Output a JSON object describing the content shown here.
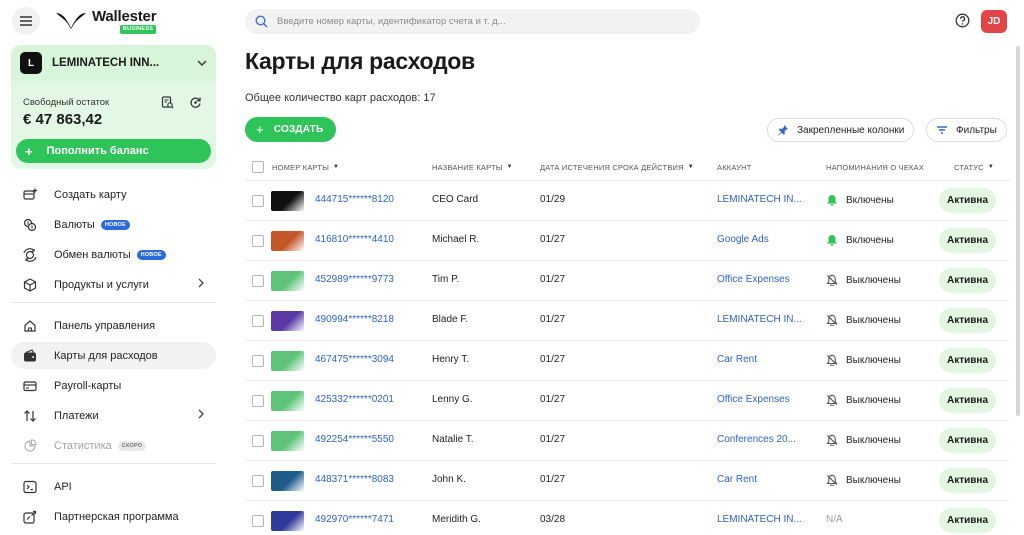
{
  "brand": {
    "name": "Wallester",
    "badge": "BUSINESS"
  },
  "company": {
    "initial": "L",
    "name": "LEMINATECH INN..."
  },
  "balance": {
    "label": "Свободный остаток",
    "value": "€ 47 863,42",
    "topup_label": "Пополнить баланс"
  },
  "nav": {
    "group1": [
      {
        "id": "create-card",
        "label": "Создать карту",
        "icon": "card-plus-icon"
      },
      {
        "id": "currencies",
        "label": "Валюты",
        "icon": "coins-icon",
        "badge": "НОВОЕ"
      },
      {
        "id": "exchange",
        "label": "Обмен валюты",
        "icon": "exchange-icon",
        "badge": "НОВОЕ"
      },
      {
        "id": "products",
        "label": "Продукты и услуги",
        "icon": "cube-icon",
        "chevron": true
      }
    ],
    "group2": [
      {
        "id": "dashboard",
        "label": "Панель управления",
        "icon": "home-icon"
      },
      {
        "id": "expense-cards",
        "label": "Карты для расходов",
        "icon": "wallet-icon",
        "active": true
      },
      {
        "id": "payroll",
        "label": "Payroll-карты",
        "icon": "payroll-card-icon"
      },
      {
        "id": "payments",
        "label": "Платежи",
        "icon": "transfer-icon",
        "chevron": true
      },
      {
        "id": "stats",
        "label": "Статистика",
        "icon": "pie-chart-icon",
        "badge": "СКОРО",
        "disabled": true
      }
    ],
    "group3": [
      {
        "id": "api",
        "label": "API",
        "icon": "terminal-icon"
      },
      {
        "id": "partner",
        "label": "Партнерская программа",
        "icon": "partner-icon"
      }
    ]
  },
  "search": {
    "placeholder": "Введите номер карты, идентификатор счета и т. д..."
  },
  "user": {
    "initials": "JD"
  },
  "page": {
    "title": "Карты для расходов",
    "total": "Общее количество карт расходов: 17",
    "create_label": "СОЗДАТЬ",
    "pinned_label": "Закрепленные колонки",
    "filters_label": "Фильтры"
  },
  "table": {
    "headers": {
      "card_number": "НОМЕР КАРТЫ",
      "card_name": "НАЗВАНИЕ КАРТЫ",
      "expiry": "ДАТА ИСТЕЧЕНИЯ СРОКА ДЕЙСТВИЯ",
      "account": "АККАУНТ",
      "reminders": "НАПОМИНАНИЯ О ЧЕКАХ",
      "status": "СТАТУС"
    },
    "rows": [
      {
        "number": "444715******8120",
        "name": "CEO Card",
        "expiry": "01/29",
        "account": "LEMINATECH IN...",
        "reminder": "Включены",
        "reminder_on": true,
        "status": "Активна",
        "card_color": "#111111"
      },
      {
        "number": "416810******4410",
        "name": "Michael R.",
        "expiry": "01/27",
        "account": "Google Ads",
        "reminder": "Включены",
        "reminder_on": true,
        "status": "Активна",
        "card_color": "#c4572a"
      },
      {
        "number": "452989******9773",
        "name": "Tim P.",
        "expiry": "01/27",
        "account": "Office Expenses",
        "reminder": "Выключены",
        "reminder_on": false,
        "status": "Активна",
        "card_color": "#5fc47a"
      },
      {
        "number": "490994******8218",
        "name": "Blade F.",
        "expiry": "01/27",
        "account": "LEMINATECH IN...",
        "reminder": "Выключены",
        "reminder_on": false,
        "status": "Активна",
        "card_color": "#5b3aa6"
      },
      {
        "number": "467475******3094",
        "name": "Henry T.",
        "expiry": "01/27",
        "account": "Car Rent",
        "reminder": "Выключены",
        "reminder_on": false,
        "status": "Активна",
        "card_color": "#5fc47a"
      },
      {
        "number": "425332******0201",
        "name": "Lenny G.",
        "expiry": "01/27",
        "account": "Office Expenses",
        "reminder": "Выключены",
        "reminder_on": false,
        "status": "Активна",
        "card_color": "#5fc47a"
      },
      {
        "number": "492254******5550",
        "name": "Natalie T.",
        "expiry": "01/27",
        "account": "Conferences 20...",
        "reminder": "Выключены",
        "reminder_on": false,
        "status": "Активна",
        "card_color": "#5fc47a"
      },
      {
        "number": "448371******8083",
        "name": "John K.",
        "expiry": "01/27",
        "account": "Car Rent",
        "reminder": "Выключены",
        "reminder_on": false,
        "status": "Активна",
        "card_color": "#1e5d8a"
      },
      {
        "number": "492970******7471",
        "name": "Meridith G.",
        "expiry": "03/28",
        "account": "LEMINATECH IN...",
        "reminder": "N/A",
        "reminder_on": null,
        "status": "Активна",
        "card_color": "#2f3a9a"
      }
    ]
  },
  "colors": {
    "accent": "#2fc45a",
    "link": "#2e63c7",
    "danger": "#e24545"
  }
}
